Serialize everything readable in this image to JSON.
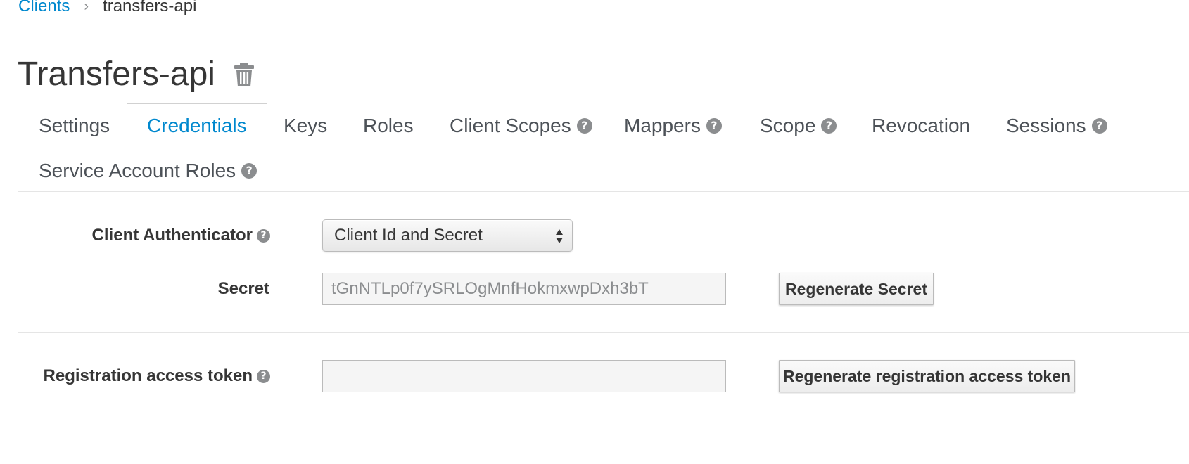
{
  "breadcrumb": {
    "parent": "Clients",
    "separator": "›",
    "current": "transfers-api"
  },
  "page": {
    "title": "Transfers-api",
    "delete_icon": "trash-icon"
  },
  "tabs": [
    {
      "label": "Settings",
      "help": false,
      "active": false
    },
    {
      "label": "Credentials",
      "help": false,
      "active": true
    },
    {
      "label": "Keys",
      "help": false,
      "active": false
    },
    {
      "label": "Roles",
      "help": false,
      "active": false
    },
    {
      "label": "Client Scopes",
      "help": true,
      "active": false
    },
    {
      "label": "Mappers",
      "help": true,
      "active": false
    },
    {
      "label": "Scope",
      "help": true,
      "active": false
    },
    {
      "label": "Revocation",
      "help": false,
      "active": false
    },
    {
      "label": "Sessions",
      "help": true,
      "active": false
    },
    {
      "label": "Service Account Roles",
      "help": true,
      "active": false
    }
  ],
  "form": {
    "client_authenticator": {
      "label": "Client Authenticator",
      "value": "Client Id and Secret"
    },
    "secret": {
      "label": "Secret",
      "value": "tGnNTLp0f7ySRLOgMnfHokmxwpDxh3bT",
      "button": "Regenerate Secret"
    },
    "registration_token": {
      "label": "Registration access token",
      "value": "",
      "button": "Regenerate registration access token"
    }
  },
  "colors": {
    "link": "#0088ce",
    "text": "#363636",
    "help_icon": "#8b8d8f"
  },
  "icons": {
    "help": "question-circle-icon",
    "select": "select-arrows-icon"
  }
}
